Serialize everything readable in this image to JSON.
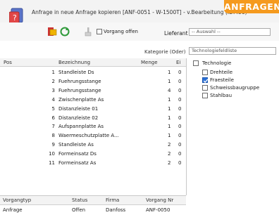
{
  "banner": "ANFRAGEN",
  "window": {
    "title": "Anfrage in neue Anfrage kopieren [ANF-0051 - W-1500T] - v.Bearbeitung (ID:456)"
  },
  "toolbar": {
    "vorgang_offen_label": "Vorgang offen",
    "lieferant_label": "Lieferant",
    "lieferant_value": "-- Auswahl --"
  },
  "filter": {
    "kategorie_label": "Kategorie (Oder)",
    "kategorie_value": "Technologiefeldliste"
  },
  "table": {
    "headers": [
      "Pos",
      "Bezeichnung",
      "Menge",
      "Ei"
    ],
    "rows": [
      {
        "pos": "1",
        "name": "Standleiste Ds",
        "menge": "1",
        "ei": "0"
      },
      {
        "pos": "2",
        "name": "Fuehrungsstange",
        "menge": "1",
        "ei": "0"
      },
      {
        "pos": "3",
        "name": "Fuehrungsstange",
        "menge": "4",
        "ei": "0"
      },
      {
        "pos": "4",
        "name": "Zwischenplatte As",
        "menge": "1",
        "ei": "0"
      },
      {
        "pos": "5",
        "name": "Distanzleiste 01",
        "menge": "1",
        "ei": "0"
      },
      {
        "pos": "6",
        "name": "Distanzleiste 02",
        "menge": "1",
        "ei": "0"
      },
      {
        "pos": "7",
        "name": "Aufspannplatte As",
        "menge": "1",
        "ei": "0"
      },
      {
        "pos": "8",
        "name": "Waermeschutzplatte A...",
        "menge": "1",
        "ei": "0"
      },
      {
        "pos": "9",
        "name": "Standleiste As",
        "menge": "2",
        "ei": "0"
      },
      {
        "pos": "10",
        "name": "Formeinsatz Ds",
        "menge": "2",
        "ei": "0"
      },
      {
        "pos": "11",
        "name": "Formeinsatz As",
        "menge": "2",
        "ei": "0"
      }
    ]
  },
  "tree": {
    "root": "Technologie",
    "children": [
      {
        "label": "Drehteile",
        "checked": false
      },
      {
        "label": "Fraesteile",
        "checked": true
      },
      {
        "label": "Schweissbaugruppe",
        "checked": false
      },
      {
        "label": "Stahlbau",
        "checked": false
      }
    ]
  },
  "bottom": {
    "headers": [
      "Vorgangtyp",
      "Status",
      "Firma",
      "Vorgang Nr"
    ],
    "row": {
      "typ": "Anfrage",
      "status": "Offen",
      "firma": "Danfoss",
      "nr": "ANF-0050"
    }
  },
  "colors": {
    "banner": "#f59a1e",
    "accent": "#2a6fd6"
  }
}
